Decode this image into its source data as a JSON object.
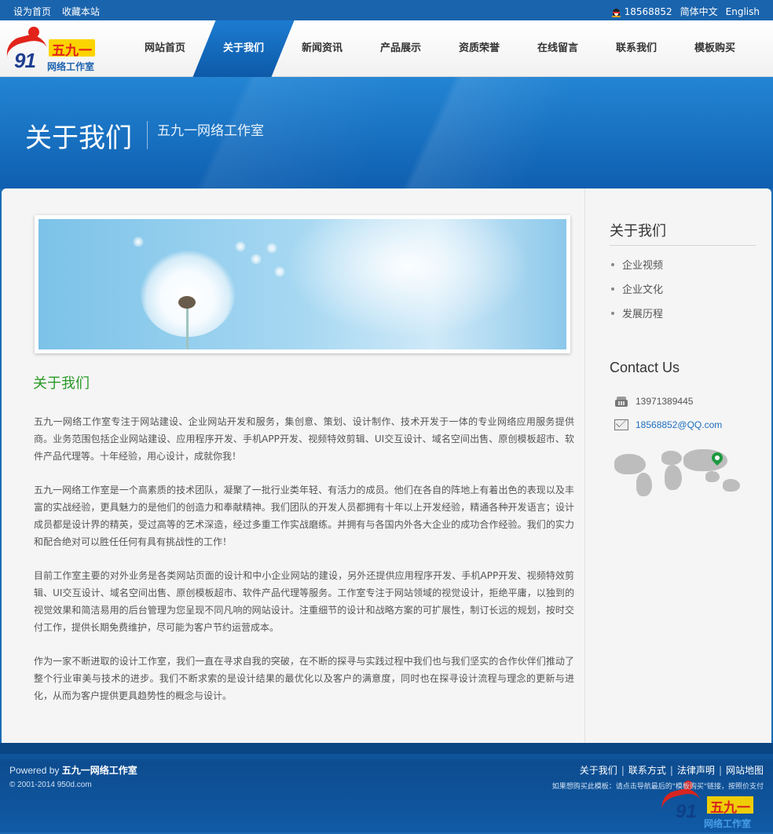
{
  "topbar": {
    "set_home": "设为首页",
    "bookmark": "收藏本站",
    "phone": "18568852",
    "lang_cn": "简体中文",
    "lang_en": "English"
  },
  "logo": {
    "number": "91",
    "brand_top": "五九一",
    "brand_sub": "网络工作室"
  },
  "nav": {
    "items": [
      {
        "label": "网站首页"
      },
      {
        "label": "关于我们"
      },
      {
        "label": "新闻资讯"
      },
      {
        "label": "产品展示"
      },
      {
        "label": "资质荣誉"
      },
      {
        "label": "在线留言"
      },
      {
        "label": "联系我们"
      },
      {
        "label": "模板购买"
      }
    ],
    "active_label": "关于我们"
  },
  "banner": {
    "title": "关于我们",
    "subtitle": "五九一网络工作室"
  },
  "content": {
    "section_title": "关于我们",
    "paragraphs": [
      "五九一网络工作室专注于网站建设、企业网站开发和服务，集创意、策划、设计制作、技术开发于一体的专业网络应用服务提供商。业务范围包括企业网站建设、应用程序开发、手机APP开发、视频特效剪辑、UI交互设计、域名空间出售、原创模板超市、软件产品代理等。十年经验，用心设计，成就你我！",
      "五九一网络工作室是一个高素质的技术团队，凝聚了一批行业类年轻、有活力的成员。他们在各自的阵地上有着出色的表现以及丰富的实战经验，更具魅力的是他们的创造力和奉献精神。我们团队的开发人员都拥有十年以上开发经验，精通各种开发语言；设计成员都是设计界的精英，受过高等的艺术深造，经过多重工作实战磨练。并拥有与各国内外各大企业的成功合作经验。我们的实力和配合绝对可以胜任任何有具有挑战性的工作！",
      "目前工作室主要的对外业务是各类网站页面的设计和中小企业网站的建设，另外还提供应用程序开发、手机APP开发、视频特效剪辑、UI交互设计、域名空间出售、原创模板超市、软件产品代理等服务。工作室专注于网站领域的视觉设计，拒绝平庸，以独到的视觉效果和简洁易用的后台管理为您呈现不同凡响的网站设计。注重细节的设计和战略方案的可扩展性，制订长远的规划，按时交付工作，提供长期免费维护，尽可能为客户节约运营成本。",
      "作为一家不断进取的设计工作室，我们一直在寻求自我的突破，在不断的探寻与实践过程中我们也与我们坚实的合作伙伴们推动了整个行业审美与技术的进步。我们不断求索的是设计结果的最优化以及客户的满意度，同时也在探寻设计流程与理念的更新与进化，从而为客户提供更具趋势性的概念与设计。"
    ]
  },
  "sidebar": {
    "title": "关于我们",
    "items": [
      {
        "label": "企业视频"
      },
      {
        "label": "企业文化"
      },
      {
        "label": "发展历程"
      }
    ],
    "contact_title": "Contact Us",
    "phone": "13971389445",
    "email": "18568852@QQ.com"
  },
  "footer": {
    "powered_prefix": "Powered by",
    "powered_name": "五九一网络工作室",
    "copyright": "© 2001-2014 950d.com",
    "links": [
      {
        "label": "关于我们"
      },
      {
        "label": "联系方式"
      },
      {
        "label": "法律声明"
      },
      {
        "label": "网站地图"
      }
    ],
    "note": "如果想购买此模板：请点击导航最后的\"模板购买\"链接，按照价支付"
  },
  "colors": {
    "brand_blue": "#1a64ad",
    "nav_active": "#1674c6",
    "section_title_green": "#2a9a28",
    "email_link": "#1e6fc0",
    "footer_bg": "#0f57a0"
  },
  "icons": [
    "qq-icon",
    "phone-icon",
    "mail-icon",
    "world-map-icon",
    "map-pin-icon"
  ]
}
